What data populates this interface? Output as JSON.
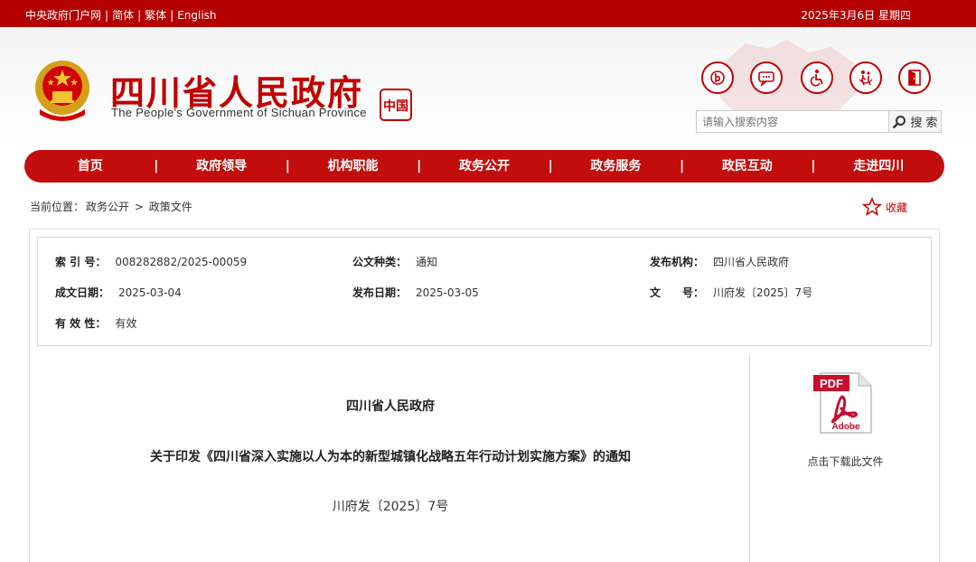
{
  "topbar": {
    "links": [
      "中央政府门户网",
      "简体",
      "繁体",
      "English"
    ],
    "separator": "|",
    "date": "2025年3月6日 星期四"
  },
  "header": {
    "title": "四川省人民政府",
    "subtitle": "The People's Government of Sichuan Province",
    "seal_text": "中国",
    "search_placeholder": "请输入搜索内容",
    "search_button": "搜 索",
    "tools": [
      "wechat-icon",
      "comment-icon",
      "accessibility-icon",
      "elderly-care-icon",
      "exit-icon"
    ]
  },
  "nav": {
    "items": [
      "首页",
      "政府领导",
      "机构职能",
      "政务公开",
      "政务服务",
      "政民互动",
      "走进四川"
    ]
  },
  "breadcrumb": {
    "prefix": "当前位置：",
    "items": [
      "政务公开",
      "政策文件"
    ],
    "separator": ">"
  },
  "favorite": {
    "label": "收藏"
  },
  "meta": {
    "index_label": "索 引 号：",
    "index_value": "008282882/2025-00059",
    "category_label": "公文种类：",
    "category_value": "通知",
    "publisher_label": "发布机构：",
    "publisher_value": "四川省人民政府",
    "created_label": "成文日期：",
    "created_value": "2025-03-04",
    "published_label": "发布日期：",
    "published_value": "2025-03-05",
    "docno_label": "文　　号：",
    "docno_value": "川府发〔2025〕7号",
    "validity_label": "有 效 性：",
    "validity_value": "有效"
  },
  "document": {
    "org": "四川省人民政府",
    "title": "关于印发《四川省深入实施以人为本的新型城镇化战略五年行动计划实施方案》的通知",
    "number": "川府发〔2025〕7号"
  },
  "download": {
    "pdf_text": "PDF",
    "adobe_text": "Adobe",
    "label": "点击下载此文件"
  },
  "colors": {
    "brand_red": "#c30d0d",
    "topbar_red": "#b50000"
  }
}
